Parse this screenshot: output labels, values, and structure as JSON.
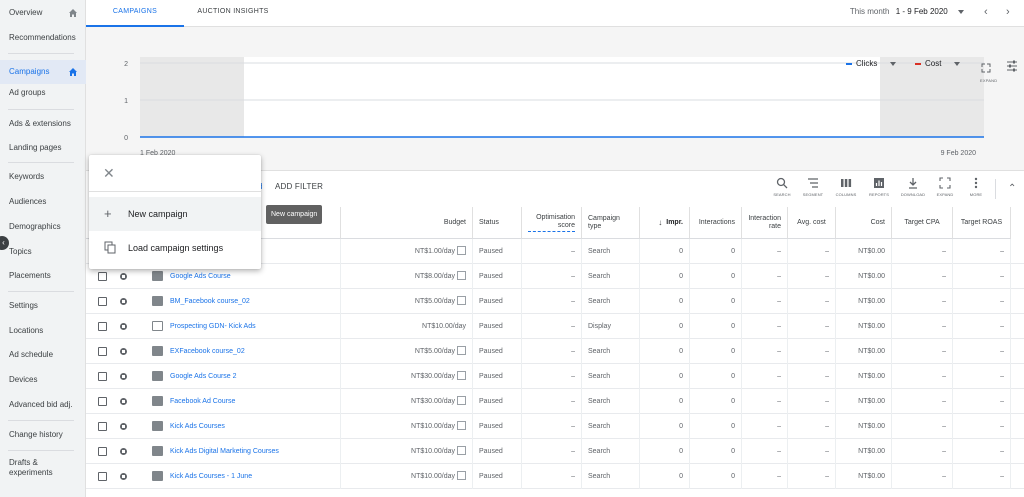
{
  "sidebar": {
    "items": [
      {
        "label": "Overview",
        "home": true
      },
      {
        "label": "Recommendations"
      },
      {
        "label": "Campaigns",
        "home": true,
        "active": true
      },
      {
        "label": "Ad groups"
      },
      {
        "label": "Ads & extensions"
      },
      {
        "label": "Landing pages"
      },
      {
        "label": "Keywords"
      },
      {
        "label": "Audiences"
      },
      {
        "label": "Demographics"
      },
      {
        "label": "Topics"
      },
      {
        "label": "Placements"
      },
      {
        "label": "Settings"
      },
      {
        "label": "Locations"
      },
      {
        "label": "Ad schedule"
      },
      {
        "label": "Devices"
      },
      {
        "label": "Advanced bid adj."
      },
      {
        "label": "Change history"
      },
      {
        "label": "Drafts & experiments"
      }
    ]
  },
  "tabs": [
    "CAMPAIGNS",
    "AUCTION INSIGHTS"
  ],
  "date": {
    "period": "This month",
    "range": "1 - 9 Feb 2020"
  },
  "chart_metrics": [
    {
      "label": "Clicks",
      "color": "#1a73e8"
    },
    {
      "label": "Cost",
      "color": "#d93025"
    }
  ],
  "chart_expand_label": "EXPAND",
  "chart_data": {
    "type": "line",
    "x": [
      "1 Feb 2020",
      "9 Feb 2020"
    ],
    "series": [
      {
        "name": "Clicks",
        "values": [
          0,
          0,
          0,
          0,
          0,
          0,
          0,
          0,
          0
        ]
      }
    ],
    "yticks": [
      "2",
      "1",
      "0"
    ],
    "ylim": [
      0,
      2
    ]
  },
  "toolbar": {
    "add_filter": "ADD FILTER",
    "buttons": [
      "SEARCH",
      "SEGMENT",
      "COLUMNS",
      "REPORTS",
      "DOWNLOAD",
      "EXPAND",
      "MORE"
    ]
  },
  "columns": {
    "budget": "Budget",
    "status": "Status",
    "optimisation": "Optimisation score",
    "campaign_type": "Campaign type",
    "impr": "Impr.",
    "interactions": "Interactions",
    "interaction_rate": "Interaction rate",
    "avg_cost": "Avg. cost",
    "cost": "Cost",
    "target_cpa": "Target CPA",
    "target_roas": "Target ROAS"
  },
  "rows": [
    {
      "name": "",
      "budget": "NT$1.00/day",
      "status": "Paused",
      "opt": "–",
      "type": "Search",
      "impr": "0",
      "inter": "0",
      "rate": "–",
      "avg": "–",
      "cost": "NT$0.00",
      "cpa": "–",
      "roas": "–",
      "bic": true
    },
    {
      "name": "Google Ads Course",
      "budget": "NT$8.00/day",
      "status": "Paused",
      "opt": "–",
      "type": "Search",
      "impr": "0",
      "inter": "0",
      "rate": "–",
      "avg": "–",
      "cost": "NT$0.00",
      "cpa": "–",
      "roas": "–",
      "bic": true
    },
    {
      "name": "BM_Facebook course_02",
      "budget": "NT$5.00/day",
      "status": "Paused",
      "opt": "–",
      "type": "Search",
      "impr": "0",
      "inter": "0",
      "rate": "–",
      "avg": "–",
      "cost": "NT$0.00",
      "cpa": "–",
      "roas": "–",
      "bic": true
    },
    {
      "name": "Prospecting GDN- Kick Ads",
      "budget": "NT$10.00/day",
      "status": "Paused",
      "opt": "–",
      "type": "Display",
      "impr": "0",
      "inter": "0",
      "rate": "–",
      "avg": "–",
      "cost": "NT$0.00",
      "cpa": "–",
      "roas": "–",
      "bic": false
    },
    {
      "name": "EXFacebook course_02",
      "budget": "NT$5.00/day",
      "status": "Paused",
      "opt": "–",
      "type": "Search",
      "impr": "0",
      "inter": "0",
      "rate": "–",
      "avg": "–",
      "cost": "NT$0.00",
      "cpa": "–",
      "roas": "–",
      "bic": true
    },
    {
      "name": "Google Ads Course 2",
      "budget": "NT$30.00/day",
      "status": "Paused",
      "opt": "–",
      "type": "Search",
      "impr": "0",
      "inter": "0",
      "rate": "–",
      "avg": "–",
      "cost": "NT$0.00",
      "cpa": "–",
      "roas": "–",
      "bic": true
    },
    {
      "name": "Facebook Ad Course",
      "budget": "NT$30.00/day",
      "status": "Paused",
      "opt": "–",
      "type": "Search",
      "impr": "0",
      "inter": "0",
      "rate": "–",
      "avg": "–",
      "cost": "NT$0.00",
      "cpa": "–",
      "roas": "–",
      "bic": true
    },
    {
      "name": "Kick Ads Courses",
      "budget": "NT$10.00/day",
      "status": "Paused",
      "opt": "–",
      "type": "Search",
      "impr": "0",
      "inter": "0",
      "rate": "–",
      "avg": "–",
      "cost": "NT$0.00",
      "cpa": "–",
      "roas": "–",
      "bic": true
    },
    {
      "name": "Kick Ads Digital Marketing Courses",
      "budget": "NT$10.00/day",
      "status": "Paused",
      "opt": "–",
      "type": "Search",
      "impr": "0",
      "inter": "0",
      "rate": "–",
      "avg": "–",
      "cost": "NT$0.00",
      "cpa": "–",
      "roas": "–",
      "bic": true
    },
    {
      "name": "Kick Ads Courses - 1 June",
      "budget": "NT$10.00/day",
      "status": "Paused",
      "opt": "–",
      "type": "Search",
      "impr": "0",
      "inter": "0",
      "rate": "–",
      "avg": "–",
      "cost": "NT$0.00",
      "cpa": "–",
      "roas": "–",
      "bic": true
    }
  ],
  "menu": {
    "items": [
      "New campaign",
      "Load campaign settings"
    ]
  },
  "tooltip": "New campaign",
  "colors": {
    "accent": "#1a73e8",
    "cost": "#d93025"
  }
}
